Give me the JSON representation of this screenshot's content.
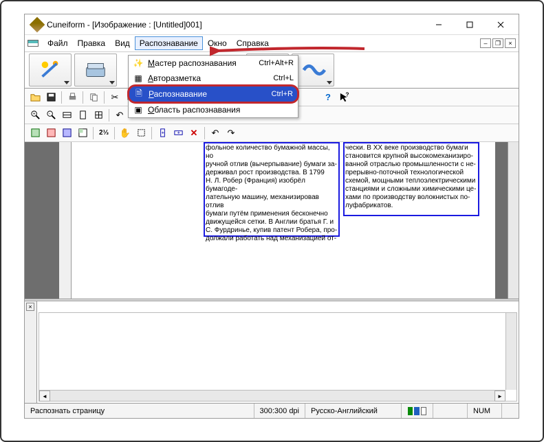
{
  "window": {
    "title": "Cuneiform - [Изображение : [Untitled]001]"
  },
  "menu": {
    "file": "Файл",
    "edit": "Правка",
    "view": "Вид",
    "recognize": "Распознавание",
    "window": "Окно",
    "help": "Справка"
  },
  "dropdown": {
    "wizard": "Мастер распознавания",
    "wizard_sc": "Ctrl+Alt+R",
    "autolayout": "Авторазметка",
    "autolayout_sc": "Ctrl+L",
    "recognize": "Распознавание",
    "recognize_sc": "Ctrl+R",
    "area": "Область распознавания"
  },
  "text_block_a": "фольное количество бумажной массы, но\nручной отлив (вычерпывание) бумаги за-\nдерживал рост производства. В 1799\nН. Л. Робер (Франция) изобрёл бумагоде-\nлательную машину, механизировав отлив\nбумаги путём применения бесконечно\nдвижущейся сетки. В Англии братья Г. и\nС. Фурдринье, купив патент Робера, про-\nдолжали работать над механизацией от-",
  "text_block_b": "чески. В XX веке производство бумаги\nстановится крупной высокомеханизиро-\nванной отраслью промышленности с не-\nпрерывно-поточной технологической\nсхемой, мощными теплоэлектрическими\nстанциями и сложными химическими це-\nхами по производству волокнистых по-\nлуфабрикатов.",
  "status": {
    "hint": "Распознать страницу",
    "dpi": "300:300 dpi",
    "lang": "Русско-Английский",
    "num": "NUM"
  }
}
